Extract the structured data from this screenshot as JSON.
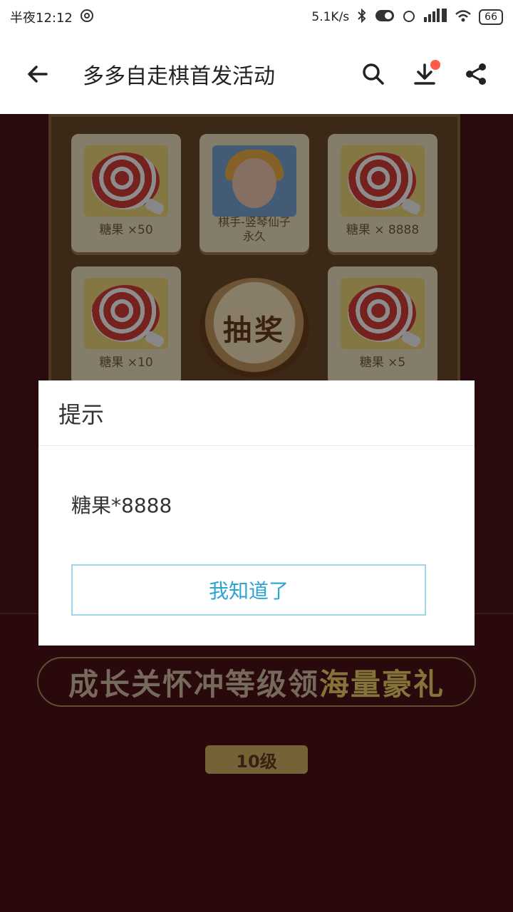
{
  "status": {
    "time": "半夜12:12",
    "speed": "5.1K/s",
    "battery": "66"
  },
  "app_bar": {
    "title": "多多自走棋首发活动"
  },
  "prizes": [
    {
      "label": "糖果 ×50"
    },
    {
      "label": "棋手-竖琴仙子\n永久"
    },
    {
      "label": "糖果 × 8888"
    },
    {
      "label": "糖果 ×10"
    },
    {
      "label": "糖果 ×5"
    }
  ],
  "draw_button": {
    "label": "抽奖"
  },
  "banner": {
    "text_normal": "成长关怀冲等级领",
    "text_highlight": "海量豪礼"
  },
  "level_ribbon": {
    "label": "10级"
  },
  "dialog": {
    "title": "提示",
    "message": "糖果*8888",
    "button": "我知道了"
  }
}
